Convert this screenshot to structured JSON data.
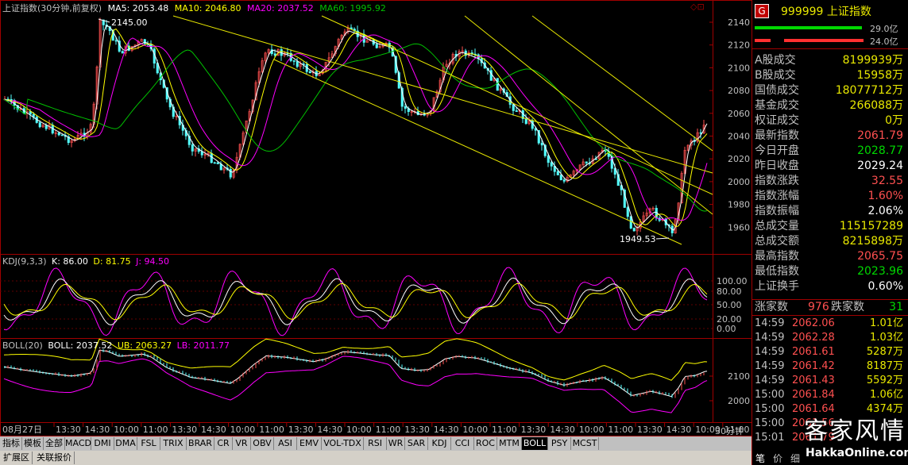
{
  "chart_header": {
    "title": "上证指数(30分钟,前复权)",
    "ma5": "MA5: 2053.48",
    "ma10": "MA10: 2046.80",
    "ma20": "MA20: 2037.52",
    "ma60": "MA60: 1995.92",
    "corner_icons": "◇⊡"
  },
  "annotations": {
    "high": "2145.00",
    "low": "1949.53"
  },
  "kdj_header": {
    "name": "KDJ(9,3,3)",
    "k": "K: 86.00",
    "d": "D: 81.75",
    "j": "J: 94.50"
  },
  "boll_header": {
    "name": "BOLL(20)",
    "boll": "BOLL: 2037.52",
    "ub": "UB: 2063.27",
    "lb": "LB: 2011.77"
  },
  "price_axis": [
    "2140",
    "2120",
    "2100",
    "2080",
    "2060",
    "2040",
    "2020",
    "2000",
    "1980",
    "1960"
  ],
  "kdj_axis": [
    "100.00",
    "80.00",
    "50.00",
    "20.00",
    "0.00"
  ],
  "boll_axis": [
    "2100",
    "2000"
  ],
  "time_axis": {
    "start": "08月27日",
    "labels": [
      "13:30",
      "14:30",
      "10:00",
      "11:00",
      "13:30",
      "14:30",
      "10:00",
      "11:00",
      "13:30",
      "14:30",
      "10:00",
      "11:00",
      "13:30",
      "14:30",
      "10:00",
      "11:00",
      "13:30",
      "14:30",
      "10:00",
      "11:00",
      "13:30",
      "14:30",
      "10:00",
      "11:00"
    ],
    "period": "30分钟"
  },
  "stock": {
    "badge": "G",
    "code_name": "999999 上证指数",
    "bar1": "29.0亿",
    "bar2": "24.0亿"
  },
  "stats": [
    {
      "label": "A股成交",
      "value": "8199939万",
      "color": "#e8e800"
    },
    {
      "label": "B股成交",
      "value": "15958万",
      "color": "#e8e800"
    },
    {
      "label": "国债成交",
      "value": "18077712万",
      "color": "#e8e800"
    },
    {
      "label": "基金成交",
      "value": "266088万",
      "color": "#e8e800"
    },
    {
      "label": "权证成交",
      "value": "0万",
      "color": "#e8e800"
    },
    {
      "label": "最新指数",
      "value": "2061.79",
      "color": "#ff5050"
    },
    {
      "label": "今日开盘",
      "value": "2028.77",
      "color": "#00d800"
    },
    {
      "label": "昨日收盘",
      "value": "2029.24",
      "color": "#ffffff"
    },
    {
      "label": "指数涨跌",
      "value": "32.55",
      "color": "#ff5050"
    },
    {
      "label": "指数涨幅",
      "value": "1.60%",
      "color": "#ff5050"
    },
    {
      "label": "指数振幅",
      "value": "2.06%",
      "color": "#ffffff"
    },
    {
      "label": "总成交量",
      "value": "115157289",
      "color": "#e8e800"
    },
    {
      "label": "总成交额",
      "value": "8215898万",
      "color": "#e8e800"
    },
    {
      "label": "最高指数",
      "value": "2065.75",
      "color": "#ff5050"
    },
    {
      "label": "最低指数",
      "value": "2023.96",
      "color": "#00d800"
    },
    {
      "label": "上证换手",
      "value": "0.60%",
      "color": "#ffffff"
    }
  ],
  "breadth": {
    "up_label": "涨家数",
    "up": "976",
    "down_label": "跌家数",
    "down": "31"
  },
  "ticks": [
    {
      "t": "14:59",
      "p": "2062.06",
      "v": "1.01亿"
    },
    {
      "t": "14:59",
      "p": "2062.28",
      "v": "1.03亿"
    },
    {
      "t": "14:59",
      "p": "2061.61",
      "v": "5287万"
    },
    {
      "t": "14:59",
      "p": "2061.42",
      "v": "8187万"
    },
    {
      "t": "14:59",
      "p": "2061.43",
      "v": "5592万"
    },
    {
      "t": "15:00",
      "p": "2061.84",
      "v": "1.06亿"
    },
    {
      "t": "15:00",
      "p": "2061.64",
      "v": "4374万"
    },
    {
      "t": "15:00",
      "p": "2061.56",
      "v": ""
    },
    {
      "t": "15:01",
      "p": "2061.79",
      "v": ""
    }
  ],
  "bottom_right_tabs": [
    "笔",
    "价",
    "细"
  ],
  "indicator_tabs": [
    "指标",
    "模板",
    "全部",
    "MACD",
    "DMI",
    "DMA",
    "FSL",
    "TRIX",
    "BRAR",
    "CR",
    "VR",
    "OBV",
    "ASI",
    "EMV",
    "VOL-TDX",
    "RSI",
    "WR",
    "SAR",
    "KDJ",
    "CCI",
    "ROC",
    "MTM",
    "BOLL",
    "PSY",
    "MCST"
  ],
  "active_tab": "BOLL",
  "bottom_tabs": [
    "扩展区",
    "关联报价"
  ],
  "watermark": {
    "cn": "客家风情",
    "url": "HakkaOnline.com"
  },
  "colors": {
    "up": "#ff5050",
    "down": "#54ffff",
    "ma5": "#ffffff",
    "ma10": "#ffff00",
    "ma20": "#ff00ff",
    "ma60": "#00c000",
    "trend": "#e8e800",
    "frame": "#a00000"
  }
}
